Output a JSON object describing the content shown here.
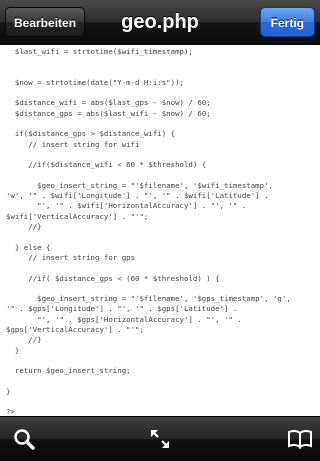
{
  "navbar": {
    "title": "geo.php",
    "left_button": "Bearbeiten",
    "right_button": "Fertig"
  },
  "code_lines": [
    "  $last_wifi = strtotime($wifi_timestamp);",
    "",
    "",
    "  $now = strtotime(date(\"Y-m-d H:i:s\"));",
    "",
    "  $distance_wifi = abs($last_gps - $now) / 60;",
    "  $distance_gps = abs($last_wifi - $now) / 60;",
    "",
    "  if($distance_gps > $distance_wifi) {",
    "     // insert string for wifi",
    "",
    "     //if($distance_wifi < 60 * $threshold) {",
    "",
    "       $geo_insert_string = \"'$filename', '$wifi_timestamp',",
    "'w', '\" . $wifi['Longitude'] . \"', '\" . $wifi['Latitude'] .",
    "       \"', '\" . $wifi['HorizontalAccuracy'] . \"', '\" .",
    "$wifi['VerticalAccuracy'] . \"'\";",
    "     //}",
    "",
    "  } else {",
    "     // insert string for gps",
    "",
    "     //if( $distance_gps < (60 * $threshold) ) {",
    "",
    "       $geo_insert_string = \"'$filename', '$gps_timestamp', 'g',",
    "'\" . $gps['Longitude'] . \"', '\" . $gps['Latitude'] .",
    "       \"', '\" . $gps['HorizontalAccuracy'] . \"', '\" .",
    "$gps['VerticalAccuracy'] . \"'\";",
    "     //}",
    "  }",
    "",
    "  return $geo_insert_string;",
    "",
    "}",
    "",
    "?>"
  ],
  "toolbar": {
    "icons": [
      "search-icon",
      "expand-icon",
      "book-icon"
    ]
  },
  "colors": {
    "nav_dark": "#1c1c1c",
    "done_blue": "#2a69da",
    "code_text": "#444444"
  }
}
